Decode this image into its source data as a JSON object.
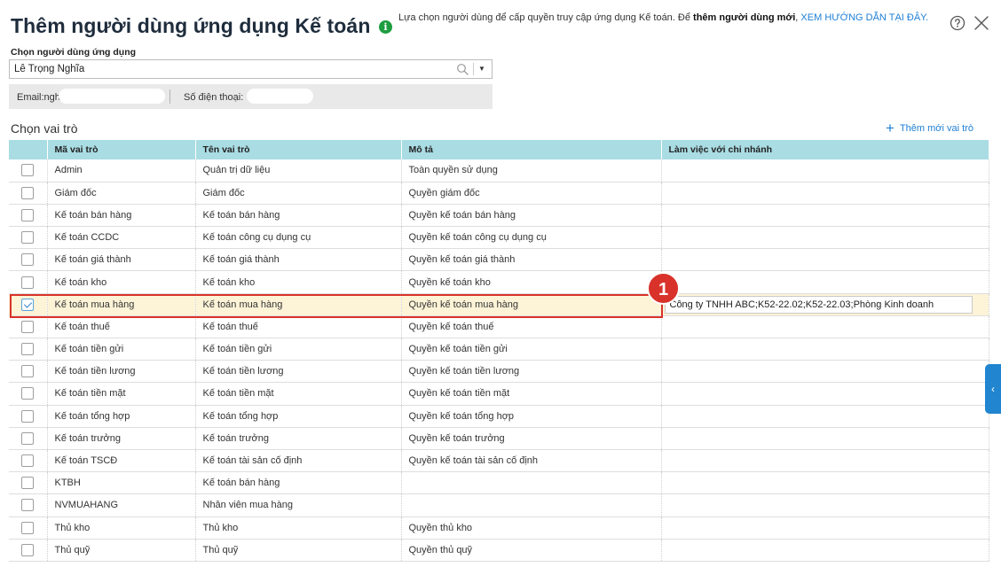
{
  "dialog": {
    "title": "Thêm người dùng ứng dụng Kế toán",
    "info": {
      "icon": "info-icon",
      "text": "Lựa chọn người dùng để cấp quyền truy cập ứng dụng Kế toán. Để ",
      "bold": "thêm người dùng mới",
      "comma": ", ",
      "link": "XEM HƯỚNG DẪN TẠI ĐÂY",
      "end": "."
    },
    "help_icon": "help-circle-icon",
    "close_icon": "close-icon"
  },
  "user_select": {
    "label": "Chọn người dùng ứng dụng",
    "value": "Lê Trọng Nghĩa"
  },
  "contact": {
    "email_label": "Email:nghial",
    "phone_label": "Số điện thoại:"
  },
  "roles": {
    "section_title": "Chọn vai trò",
    "add_label": "Thêm mới vai trò",
    "columns": [
      "Mã vai trò",
      "Tên vai trò",
      "Mô tả",
      "Làm việc với chi nhánh"
    ],
    "rows": [
      {
        "code": "Admin",
        "name": "Quản trị dữ liệu",
        "desc": "Toàn quyền sử dụng",
        "branch": "",
        "checked": false
      },
      {
        "code": "Giám đốc",
        "name": "Giám đốc",
        "desc": "Quyền giám đốc",
        "branch": "",
        "checked": false
      },
      {
        "code": "Kế toán bán hàng",
        "name": "Kế toán bán hàng",
        "desc": "Quyền kế toán bán hàng",
        "branch": "",
        "checked": false
      },
      {
        "code": "Kế toán CCDC",
        "name": "Kế toán công cụ dụng cụ",
        "desc": "Quyền kế toán công cụ dụng cụ",
        "branch": "",
        "checked": false
      },
      {
        "code": "Kế toán giá thành",
        "name": "Kế toán giá thành",
        "desc": "Quyền kế toán giá thành",
        "branch": "",
        "checked": false
      },
      {
        "code": "Kế toán kho",
        "name": "Kế toán kho",
        "desc": "Quyền kế toán kho",
        "branch": "",
        "checked": false
      },
      {
        "code": "Kế toán mua hàng",
        "name": "Kế toán mua hàng",
        "desc": "Quyền kế toán mua hàng",
        "branch": "Công ty TNHH ABC;K52-22.02;K52-22.03;Phòng Kinh doanh",
        "checked": true
      },
      {
        "code": "Kế toán thuế",
        "name": "Kế toán thuế",
        "desc": "Quyền kế toán thuế",
        "branch": "",
        "checked": false
      },
      {
        "code": "Kế toán tiền gửi",
        "name": "Kế toán tiền gửi",
        "desc": "Quyền kế toán tiền gửi",
        "branch": "",
        "checked": false
      },
      {
        "code": "Kế toán tiền lương",
        "name": "Kế toán tiền lương",
        "desc": "Quyền kế toán tiền lương",
        "branch": "",
        "checked": false
      },
      {
        "code": "Kế toán tiền mặt",
        "name": "Kế toán tiền mặt",
        "desc": "Quyền kế toán tiền mặt",
        "branch": "",
        "checked": false
      },
      {
        "code": "Kế toán tổng hợp",
        "name": "Kế toán tổng hợp",
        "desc": "Quyền kế toán tổng hợp",
        "branch": "",
        "checked": false
      },
      {
        "code": "Kế toán trưởng",
        "name": "Kế toán trưởng",
        "desc": "Quyền kế toán trưởng",
        "branch": "",
        "checked": false
      },
      {
        "code": "Kế toán TSCĐ",
        "name": "Kế toán tài sản cố định",
        "desc": "Quyền kế toán tài sản cố định",
        "branch": "",
        "checked": false
      },
      {
        "code": "KTBH",
        "name": "Kế toán bán hàng",
        "desc": "",
        "branch": "",
        "checked": false
      },
      {
        "code": "NVMUAHANG",
        "name": "Nhân viên mua hàng",
        "desc": "",
        "branch": "",
        "checked": false
      },
      {
        "code": "Thủ kho",
        "name": "Thủ kho",
        "desc": "Quyền thủ kho",
        "branch": "",
        "checked": false
      },
      {
        "code": "Thủ quỹ",
        "name": "Thủ quỹ",
        "desc": "Quyền thủ quỹ",
        "branch": "",
        "checked": false
      }
    ]
  },
  "annotation": {
    "step": "1",
    "color": "#d9322a"
  },
  "side_toggle": {
    "glyph": "‹"
  }
}
